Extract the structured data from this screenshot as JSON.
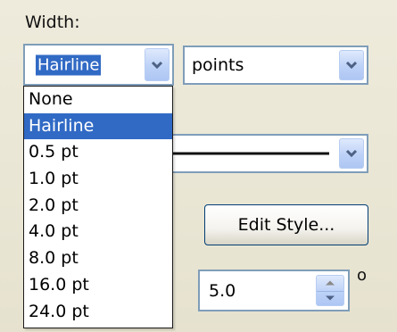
{
  "width_label": "Width:",
  "width_combo": {
    "selected_value": "Hairline"
  },
  "units_combo": {
    "selected_value": "points"
  },
  "width_options": [
    "None",
    "Hairline",
    "0.5 pt",
    "1.0 pt",
    "2.0 pt",
    "4.0 pt",
    "8.0 pt",
    "16.0 pt",
    "24.0 pt"
  ],
  "selected_option_index": 1,
  "edit_style_button": {
    "label": "Edit Style..."
  },
  "angle_spinner": {
    "value": "5.0",
    "unit_symbol": "o"
  },
  "colors": {
    "selection": "#316ac5",
    "field_border": "#7f9db9",
    "background": "#ece9d8"
  }
}
